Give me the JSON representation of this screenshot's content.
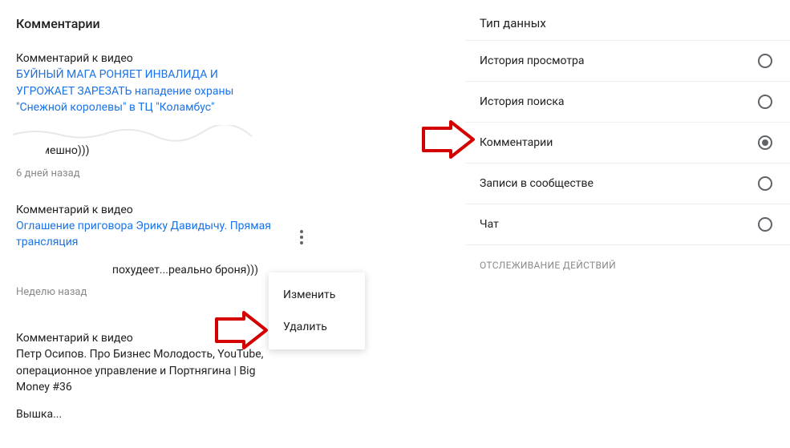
{
  "left": {
    "title": "Комментарии",
    "comments": [
      {
        "prefix": "Комментарий",
        "suffix": " к видео",
        "video_title": "БУЙНЫЙ МАГА РОНЯЕТ ИНВАЛИДА И УГРОЖАЕТ ЗАРЕЗАТЬ нападение охраны \"Снежной королевы\" в ТЦ \"Коламбус\"",
        "body_partial": "смешно)))",
        "time": "6 дней назад"
      },
      {
        "prefix": "Комментарий",
        "suffix": " к видео",
        "video_title": "Оглашение приговора Эрику Давидычу. Прямая трансляция",
        "body_partial": "похудеет...реально броня)))",
        "time": "Неделю назад"
      },
      {
        "prefix": "Комментарий",
        "suffix": " к видео",
        "video_title_plain": "Петр Осипов. Про Бизнес Молодость, YouTube, операционное управление и Портнягина | Big Money #36",
        "body_partial": "Вышка...",
        "time": ""
      }
    ],
    "menu": {
      "edit": "Изменить",
      "delete": "Удалить"
    }
  },
  "right": {
    "title": "Тип данных",
    "options": [
      {
        "label": "История просмотра",
        "selected": false
      },
      {
        "label": "История поиска",
        "selected": false
      },
      {
        "label": "Комментарии",
        "selected": true
      },
      {
        "label": "Записи в сообществе",
        "selected": false
      },
      {
        "label": "Чат",
        "selected": false
      }
    ],
    "tracking_header": "ОТСЛЕЖИВАНИЕ ДЕЙСТВИЙ"
  }
}
